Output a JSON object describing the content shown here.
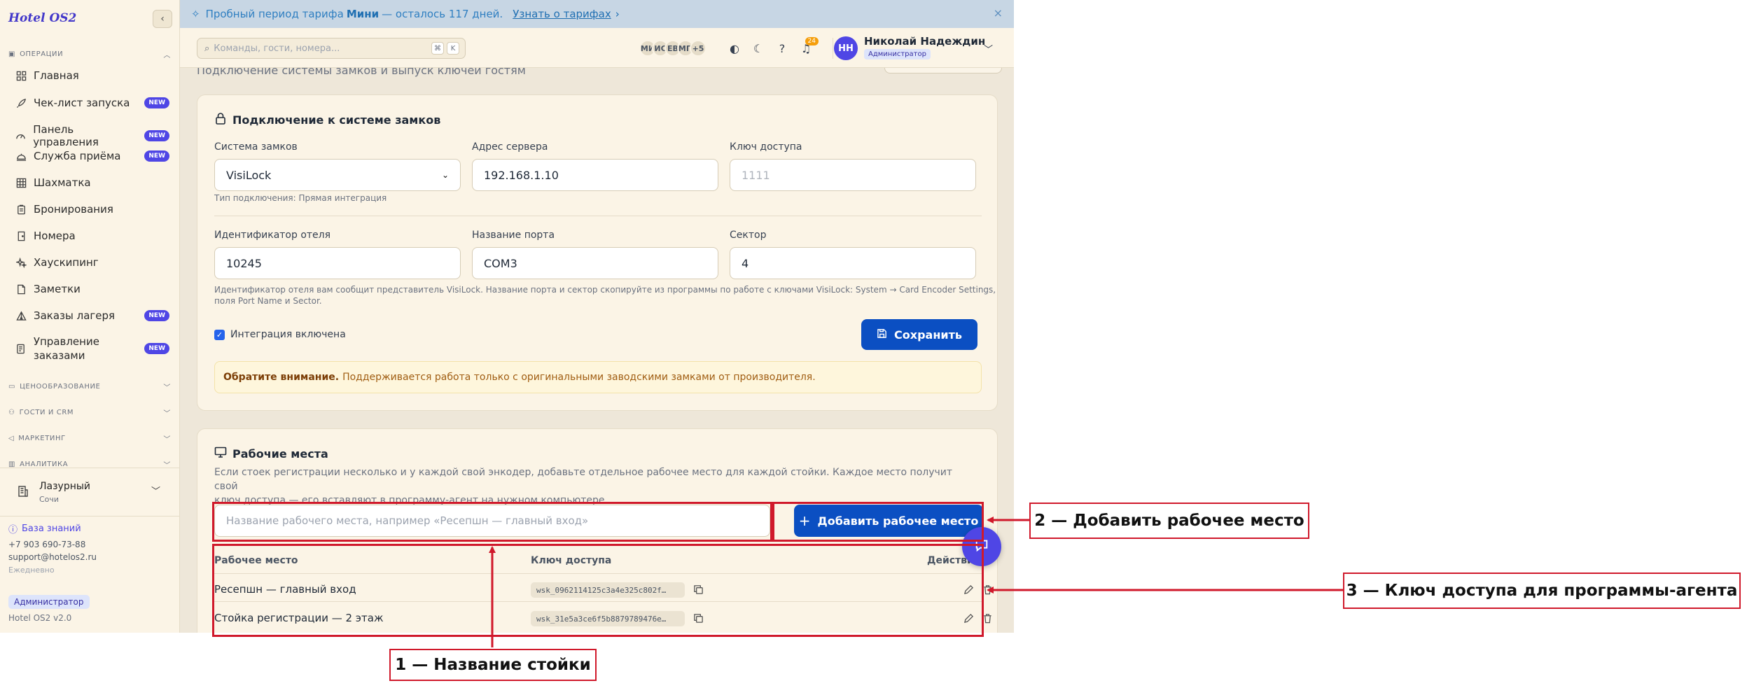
{
  "app": {
    "brand": "Hotel OS2",
    "collapse_icon": "chevron-left-icon"
  },
  "sidebar": {
    "sections": [
      {
        "label": "ОПЕРАЦИИ",
        "expanded": true
      },
      {
        "label": "ЦЕНООБРАЗОВАНИЕ",
        "expanded": false
      },
      {
        "label": "ГОСТИ И CRM",
        "expanded": false
      },
      {
        "label": "МАРКЕТИНГ",
        "expanded": false
      },
      {
        "label": "АНАЛИТИКА",
        "expanded": false
      }
    ],
    "items": [
      {
        "label": "Главная",
        "icon": "grid-icon",
        "badge": ""
      },
      {
        "label": "Чек-лист запуска",
        "icon": "rocket-icon",
        "badge": "NEW"
      },
      {
        "label": "Панель управления",
        "icon": "gauge-icon",
        "badge": "NEW"
      },
      {
        "label": "Служба приёма",
        "icon": "bell-desk-icon",
        "badge": "NEW"
      },
      {
        "label": "Шахматка",
        "icon": "table-icon",
        "badge": ""
      },
      {
        "label": "Бронирования",
        "icon": "clipboard-icon",
        "badge": ""
      },
      {
        "label": "Номера",
        "icon": "door-icon",
        "badge": ""
      },
      {
        "label": "Хаускипинг",
        "icon": "sparkle-icon",
        "badge": ""
      },
      {
        "label": "Заметки",
        "icon": "note-icon",
        "badge": ""
      },
      {
        "label": "Заказы лагеря",
        "icon": "tent-icon",
        "badge": "NEW"
      },
      {
        "label": "Управление заказами",
        "icon": "receipt-icon",
        "badge": "NEW"
      }
    ],
    "hotel": {
      "name": "Лазурный",
      "city": "Сочи"
    },
    "knowledge_base": "База знаний",
    "phone": "+7 903 690-73-88",
    "email": "support@hotelos2.ru",
    "schedule": "Ежедневно",
    "role": "Администратор",
    "version": "Hotel OS2 v2.0"
  },
  "banner": {
    "text_before": "Пробный период тарифа",
    "plan": "Мини",
    "text_after": "— осталось 117 дней.",
    "link": "Узнать о тарифах",
    "link_arrow": "›",
    "close": "×"
  },
  "header": {
    "search_placeholder": "Команды, гости, номера...",
    "kbd": [
      "⌘",
      "K"
    ],
    "avatars": [
      "МИ",
      "ИС",
      "ЕВ",
      "МП",
      "+5"
    ],
    "notifications_count": "24",
    "user": {
      "initials": "НН",
      "name": "Николай Надеждин",
      "role": "Администратор"
    }
  },
  "main": {
    "subtitle": "Подключение системы замков и выпуск ключей гостям",
    "lock_card": {
      "title": "Подключение к системе замков",
      "system_label": "Система замков",
      "system_value": "VisiLock",
      "server_label": "Адрес сервера",
      "server_value": "192.168.1.10",
      "key_label": "Ключ доступа",
      "key_placeholder": "1111",
      "connection_hint": "Тип подключения: Прямая интеграция",
      "hotel_id_label": "Идентификатор отеля",
      "hotel_id_value": "10245",
      "port_label": "Название порта",
      "port_value": "COM3",
      "sector_label": "Сектор",
      "sector_value": "4",
      "hint_line1": "Идентификатор отеля вам сообщит представитель VisiLock. Название порта и сектор скопируйте из программы по работе с ключами VisiLock: System → Card Encoder Settings,",
      "hint_line2": "поля Port Name и Sector.",
      "enabled_label": "Интеграция включена",
      "save_label": "Сохранить",
      "note_bold": "Обратите внимание.",
      "note_text": "Поддерживается работа только с оригинальными заводскими замками от производителя."
    },
    "workplaces": {
      "title": "Рабочие места",
      "desc_line1": "Если стоек регистрации несколько и у каждой свой энкодер, добавьте отдельное рабочее место для каждой стойки. Каждое место получит свой",
      "desc_line2": "ключ доступа — его вставляют в программу-агент на нужном компьютере.",
      "input_placeholder": "Название рабочего места, например «Ресепшн — главный вход»",
      "add_label": "Добавить рабочее место",
      "columns": [
        "Рабочее место",
        "Ключ доступа",
        "Действия"
      ],
      "rows": [
        {
          "name": "Ресепшн — главный вход",
          "key": "wsk_0962114125c3a4e325c802f…"
        },
        {
          "name": "Стойка регистрации — 2 этаж",
          "key": "wsk_31e5a3ce6f5b8879789476e…"
        }
      ]
    }
  },
  "annotations": {
    "label1": "1 — Название стойки",
    "label2": "2 — Добавить рабочее место",
    "label3": "3 — Ключ доступа для программы-агента"
  },
  "colors": {
    "accent": "#4f46e5",
    "primary_button": "#0b4fc2",
    "annotation_red": "#d0192b",
    "banner_bg": "#c7d6e4",
    "sidebar_bg": "#fbf4e6"
  }
}
